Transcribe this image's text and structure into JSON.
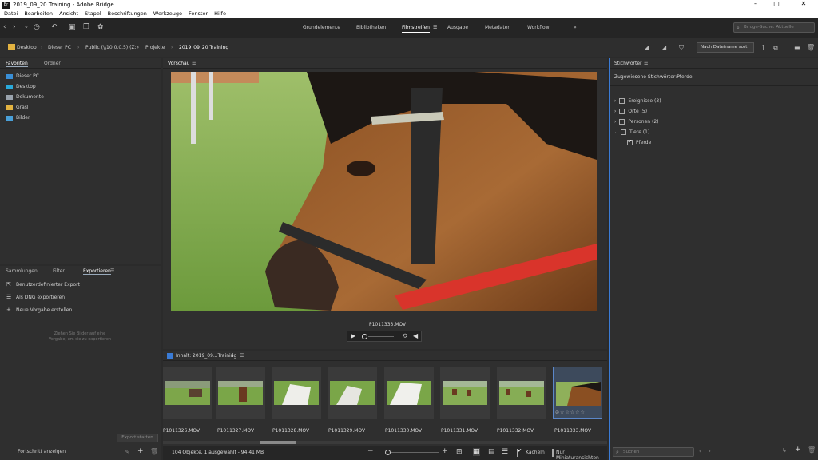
{
  "window": {
    "title": "2019_09_20 Training - Adobe Bridge",
    "app_logo": "Br"
  },
  "menu": [
    "Datei",
    "Bearbeiten",
    "Ansicht",
    "Stapel",
    "Beschriftungen",
    "Werkzeuge",
    "Fenster",
    "Hilfe"
  ],
  "workspaces": [
    {
      "label": "Grundelemente"
    },
    {
      "label": "Bibliotheken"
    },
    {
      "label": "Filmstreifen",
      "active": true
    },
    {
      "label": "Ausgabe"
    },
    {
      "label": "Metadaten"
    },
    {
      "label": "Workflow"
    }
  ],
  "search": {
    "placeholder": "Bridge-Suche: Aktuelle"
  },
  "breadcrumb": [
    "Desktop",
    "Dieser PC",
    "Public (\\\\10.0.0.5) (Z:)",
    "Projekte",
    "2019_09_20 Training"
  ],
  "sort": {
    "label": "Nach Dateiname sort"
  },
  "left_top": {
    "tabs": [
      "Favoriten",
      "Ordner"
    ],
    "favorites": [
      {
        "label": "Dieser PC",
        "icon": "computer-icon",
        "color": "#3a8fd6"
      },
      {
        "label": "Desktop",
        "icon": "desktop-icon",
        "color": "#2aa9d9"
      },
      {
        "label": "Dokumente",
        "icon": "documents-icon",
        "color": "#9aa3ad"
      },
      {
        "label": "Grasl",
        "icon": "folder-icon",
        "color": "#e3b341"
      },
      {
        "label": "Bilder",
        "icon": "pictures-icon",
        "color": "#4aa0d8"
      }
    ]
  },
  "left_bottom": {
    "tabs": [
      "Sammlungen",
      "Filter",
      "Exportieren"
    ],
    "items": [
      {
        "label": "Benutzerdefinierter Export",
        "icon": "export-icon"
      },
      {
        "label": "Als DNG exportieren",
        "icon": "list-icon"
      },
      {
        "label": "Neue Vorgabe erstellen",
        "icon": "plus-icon"
      }
    ],
    "hint": "Ziehen Sie Bilder auf eine Vorgabe, um sie zu exportieren",
    "export_button": "Export starten",
    "progress_label": "Fortschritt anzeigen"
  },
  "preview": {
    "header": "Vorschau",
    "filename": "P1011333.MOV"
  },
  "content": {
    "header": "Inhalt: 2019_09...Training",
    "thumbnails": [
      {
        "label": "P1011326.MOV"
      },
      {
        "label": "P1011327.MOV"
      },
      {
        "label": "P1011328.MOV"
      },
      {
        "label": "P1011329.MOV"
      },
      {
        "label": "P1011330.MOV"
      },
      {
        "label": "P1011331.MOV"
      },
      {
        "label": "P1011332.MOV"
      },
      {
        "label": "P1011333.MOV",
        "selected": true
      }
    ],
    "status": "104 Objekte, 1 ausgewählt - 94,41 MB",
    "view_kacheln": "Kacheln",
    "view_miniatur": "Nur Miniaturansichten"
  },
  "keywords": {
    "header": "Stichwörter",
    "assigned": "Zugewiesene Stichwörter:Pferde",
    "items": [
      {
        "label": "Ereignisse",
        "count": "(3)",
        "expanded": false
      },
      {
        "label": "Orte",
        "count": "(5)",
        "expanded": false
      },
      {
        "label": "Personen",
        "count": "(2)",
        "expanded": false
      },
      {
        "label": "Tiere",
        "count": "(1)",
        "expanded": true
      }
    ],
    "child": {
      "label": "Pferde",
      "checked": true
    },
    "search_placeholder": "Suchen"
  },
  "colors": {
    "accent": "#3a7bd5",
    "red": "#d9342b"
  }
}
